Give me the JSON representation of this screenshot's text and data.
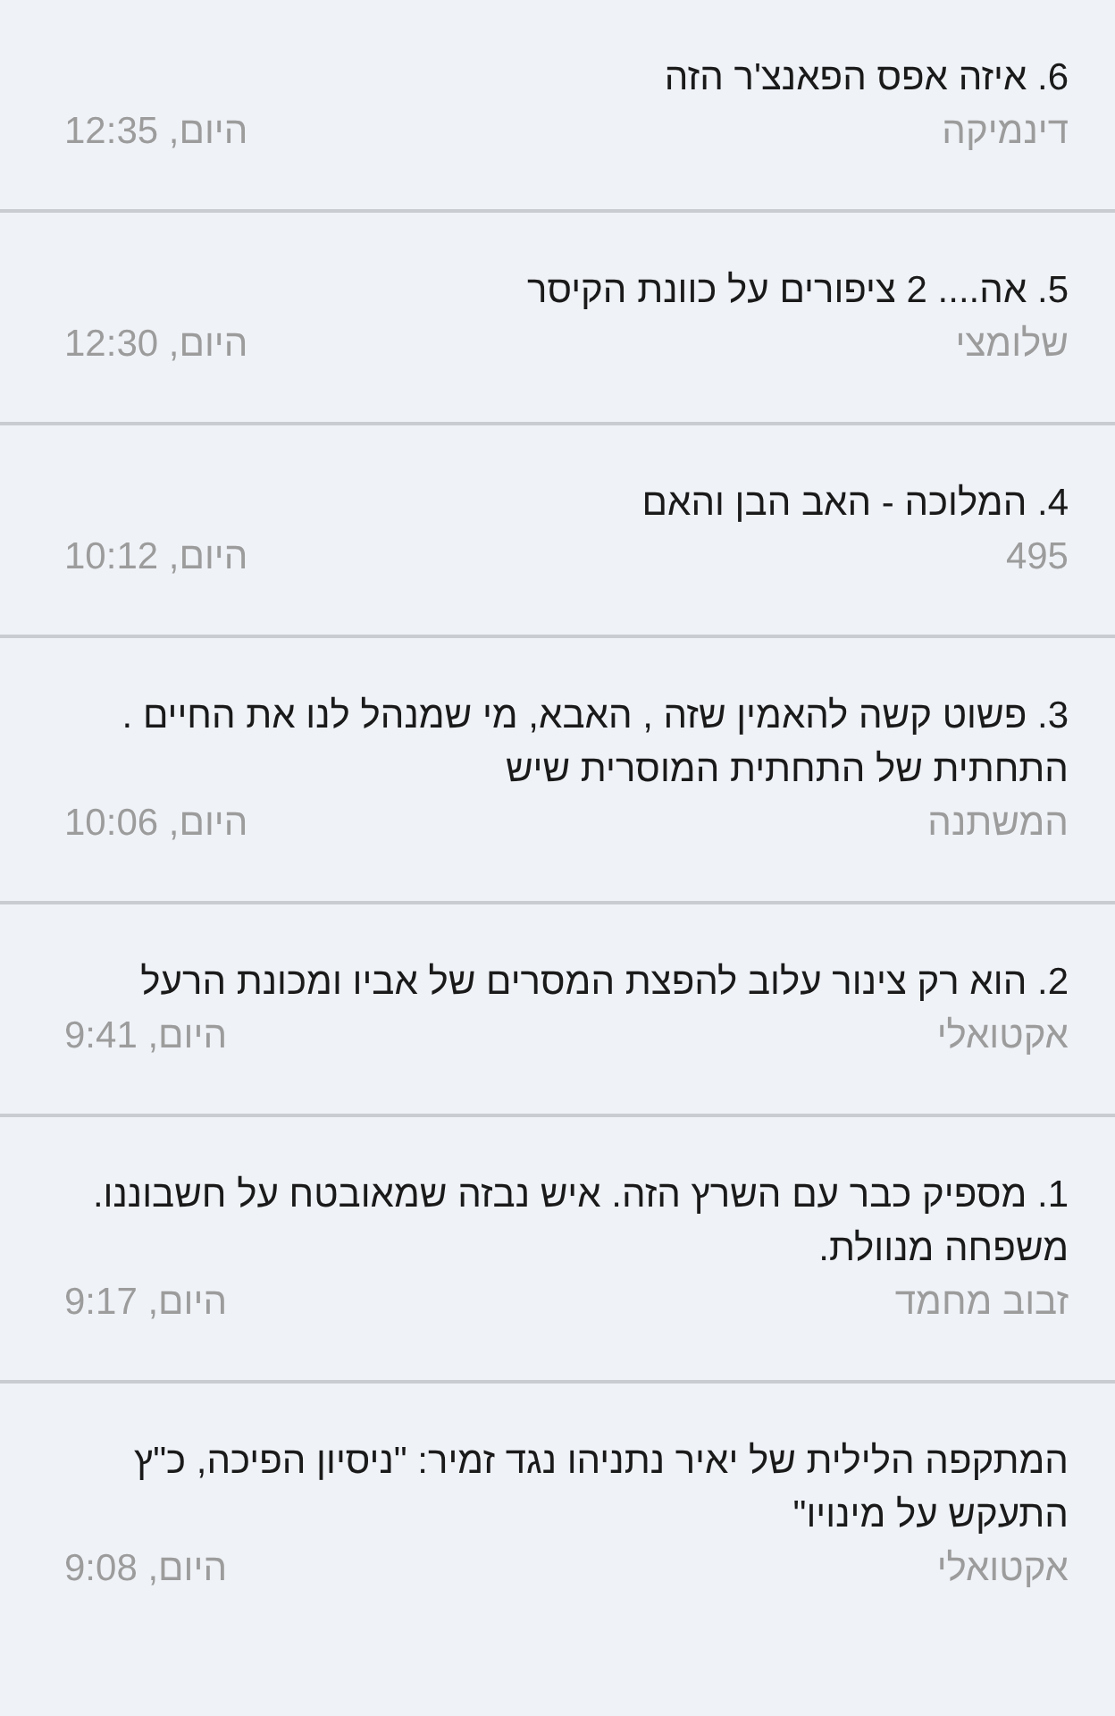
{
  "articles": [
    {
      "title": "6. איזה אפס הפאנצ'ר הזה",
      "source": "דינמיקה",
      "time": "היום, 12:35"
    },
    {
      "title": "5. אה.... 2 ציפורים על כוונת הקיסר",
      "source": "שלומצי",
      "time": "היום, 12:30"
    },
    {
      "title": "4. המלוכה - האב הבן והאם",
      "source": "495",
      "time": "היום, 10:12"
    },
    {
      "title": "3. פשוט קשה להאמין שזה , האבא, מי שמנהל לנו את החיים . התחתית של התחתית המוסרית שיש",
      "source": "המשתנה",
      "time": "היום, 10:06"
    },
    {
      "title": "2. הוא רק צינור עלוב להפצת המסרים של אביו ומכונת הרעל",
      "source": "אקטואלי",
      "time": "היום, 9:41"
    },
    {
      "title": "1. מספיק כבר עם השרץ הזה. איש נבזה שמאובטח על חשבוננו. משפחה מנוולת.",
      "source": "זבוב מחמד",
      "time": "היום, 9:17"
    },
    {
      "title": "המתקפה הלילית של יאיר נתניהו נגד זמיר: \"ניסיון הפיכה, כ\"ץ התעקש על מינויו\"",
      "source": "אקטואלי",
      "time": "היום, 9:08"
    }
  ]
}
